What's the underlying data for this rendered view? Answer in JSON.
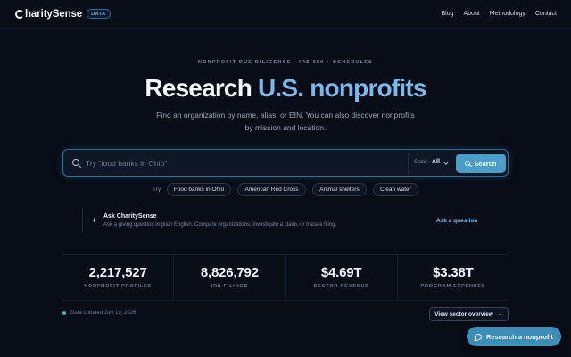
{
  "nav": {
    "brand": "harity",
    "brand_bold": "Sense",
    "badge": "DATA",
    "links": [
      "Blog",
      "About",
      "Methodology",
      "Contact"
    ]
  },
  "hero": {
    "eyebrow": "NONPROFIT DUE DILIGENCE · IRS 990 + SCHEDULES",
    "title_main": "Research",
    "title_accent": "U.S. nonprofits",
    "subtitle": "Find an organization by name, alias, or EIN. You can also discover nonprofits by mission and location."
  },
  "search": {
    "placeholder": "Try \"food banks in Ohio\"",
    "value": "",
    "state_label": "State:",
    "state_value": "All",
    "button_label": "Search"
  },
  "suggestions": {
    "try_label": "Try",
    "chips": [
      "Food banks in Ohio",
      "American Red Cross",
      "Animal shelters",
      "Clean water"
    ]
  },
  "ask": {
    "title": "Ask CharitySense",
    "description": "Ask a giving question in plain English. Compare organizations, investigate a claim, or trace a filing.",
    "link": "Ask a question"
  },
  "stats": [
    {
      "value": "2,217,527",
      "label": "NONPROFIT PROFILES"
    },
    {
      "value": "8,826,792",
      "label": "IRS FILINGS"
    },
    {
      "value": "$4.69T",
      "label": "SECTOR REVENUE"
    },
    {
      "value": "$3.38T",
      "label": "PROGRAM EXPENSES"
    }
  ],
  "footer": {
    "updated": "Data updated July 19, 2026",
    "sector_button": "View sector overview",
    "arrow": "→"
  },
  "fab": {
    "label": "Research a nonprofit"
  },
  "icons": {
    "search": "search-icon",
    "sparkle": "sparkle-icon",
    "chat": "chat-icon"
  },
  "colors": {
    "background": "#080d18",
    "accent": "#7cb8ec",
    "button": "#4a9ec7",
    "status_dot": "#3fb59b"
  }
}
